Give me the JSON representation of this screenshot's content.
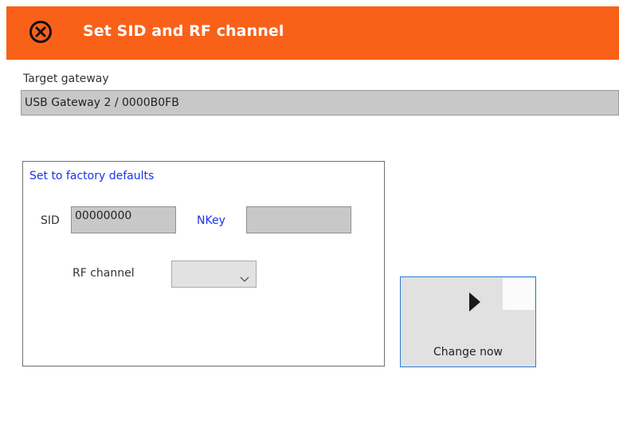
{
  "window": {
    "title": "Set SID and RF channel",
    "accent_color": "#f96119",
    "close_icon": "close-circle-icon"
  },
  "target_gateway": {
    "label": "Target gateway",
    "value": "USB Gateway 2 / 0000B0FB"
  },
  "config_group": {
    "factory_defaults_link": "Set to factory defaults",
    "sid": {
      "label": "SID",
      "value": "00000000"
    },
    "nkey": {
      "label": "NKey",
      "value": ""
    },
    "rf_channel": {
      "label": "RF channel",
      "selected": ""
    }
  },
  "actions": {
    "change_now_label": "Change now",
    "change_now_icon": "play-icon"
  }
}
